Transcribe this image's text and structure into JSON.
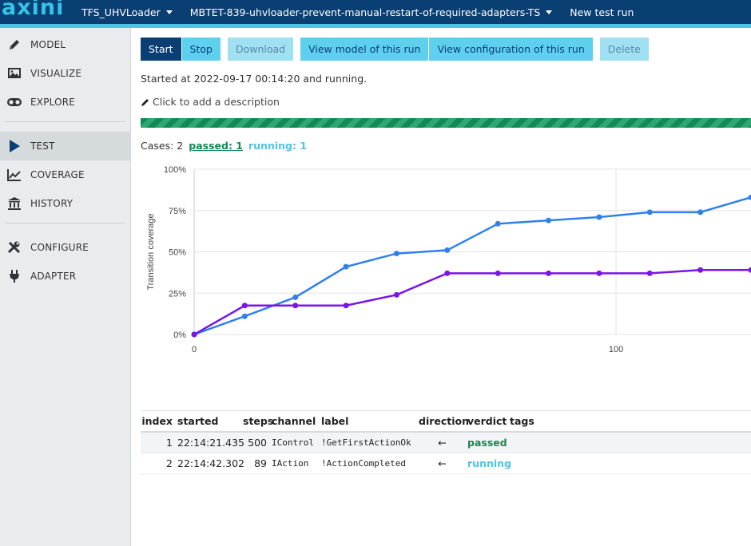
{
  "app": {
    "logo": "axini",
    "colors": {
      "navy": "#0a3f73",
      "cyan": "#4fc3e6",
      "green": "#128a54",
      "blue": "#2f80ed",
      "purple": "#7b14e6"
    }
  },
  "topnav": {
    "project": "TFS_UHVLoader",
    "run": "MBTET-839-uhvloader-prevent-manual-restart-of-required-adapters-TS",
    "new_run": "New test run"
  },
  "sidebar": {
    "items": [
      {
        "label": "MODEL",
        "icon": "pencil-icon"
      },
      {
        "label": "VISUALIZE",
        "icon": "image-icon"
      },
      {
        "label": "EXPLORE",
        "icon": "binoculars-icon"
      },
      {
        "label": "TEST",
        "icon": "play-icon"
      },
      {
        "label": "COVERAGE",
        "icon": "line-chart-icon"
      },
      {
        "label": "HISTORY",
        "icon": "bank-icon"
      },
      {
        "label": "CONFIGURE",
        "icon": "tools-icon"
      },
      {
        "label": "ADAPTER",
        "icon": "plug-icon"
      }
    ],
    "active": "TEST"
  },
  "toolbar": {
    "start": "Start",
    "stop": "Stop",
    "download": "Download",
    "view_model": "View model of this run",
    "view_config": "View configuration of this run",
    "delete": "Delete"
  },
  "run": {
    "status": "Started at 2022-09-17 00:14:20 and running.",
    "description_prompt": "Click to add a description",
    "progress": 1.0
  },
  "cases": {
    "summary": "Cases: 2",
    "passed": "passed: 1",
    "running": "running: 1"
  },
  "chart_data": {
    "type": "line",
    "ylabel": "Transition coverage",
    "xlabel": "",
    "xlim": [
      0,
      132
    ],
    "ylim": [
      0,
      100
    ],
    "y_ticks": [
      "0%",
      "25%",
      "50%",
      "75%",
      "100%"
    ],
    "x_ticks": [
      "0",
      "100"
    ],
    "grid": true,
    "series": [
      {
        "color": "#2f80ed",
        "x": [
          0,
          12,
          24,
          36,
          48,
          60,
          72,
          84,
          96,
          108,
          120,
          132
        ],
        "y": [
          0,
          11,
          22.5,
          41,
          49,
          51,
          67,
          69,
          71,
          74,
          74,
          83
        ]
      },
      {
        "color": "#7b14e6",
        "x": [
          0,
          12,
          24,
          36,
          48,
          60,
          72,
          84,
          96,
          108,
          120,
          132
        ],
        "y": [
          0,
          17.5,
          17.5,
          17.5,
          24,
          37,
          37,
          37,
          37,
          37,
          39,
          39
        ]
      }
    ]
  },
  "table": {
    "headers": {
      "index": "index",
      "started": "started",
      "steps": "steps",
      "channel": "channel",
      "label": "label",
      "direction": "direction",
      "verdict": "verdict",
      "tags": "tags"
    },
    "rows": [
      {
        "index": "1",
        "started": "22:14:21.435",
        "steps": "500",
        "channel": "IControl",
        "label": "!GetFirstActionOk",
        "direction": "←",
        "verdict": "passed"
      },
      {
        "index": "2",
        "started": "22:14:42.302",
        "steps": "89",
        "channel": "IAction",
        "label": "!ActionCompleted",
        "direction": "←",
        "verdict": "running"
      }
    ]
  }
}
